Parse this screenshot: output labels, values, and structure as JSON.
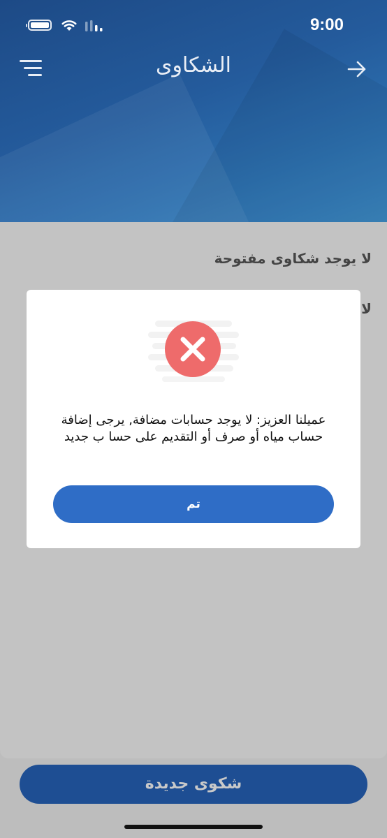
{
  "status_bar": {
    "time": "9:00",
    "battery_icon": "battery-icon",
    "wifi_icon": "wifi-icon",
    "signal_icon": "signal-icon"
  },
  "header": {
    "title": "الشكاوى",
    "menu_icon": "menu-icon",
    "back_icon": "arrow-right-icon"
  },
  "content": {
    "open_complaints_label": "لا يوجد شكاوى مفتوحة",
    "closed_complaints_label": "لا"
  },
  "modal": {
    "icon": "error-x-icon",
    "message": "عميلنا العزيز: لا يوجد حسابات مضافة, يرجى إضافة حساب مياه أو صرف أو التقديم على حسا ب جديد",
    "ok_label": "تم"
  },
  "footer": {
    "new_complaint_label": "شكوى جديدة"
  },
  "colors": {
    "header_gradient_start": "#1d4a86",
    "header_gradient_end": "#3b86bf",
    "error_red": "#ee6b6b",
    "button_blue": "#2f6dc6",
    "new_button_blue": "#1e4e93"
  }
}
